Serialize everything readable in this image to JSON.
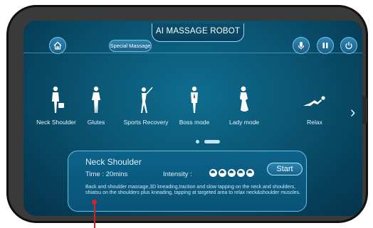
{
  "header": {
    "title": "AI MASSAGE ROBOT",
    "special_label": "Special Massage",
    "icons": [
      "home-icon",
      "microphone-icon",
      "pause-icon",
      "power-icon"
    ]
  },
  "modes": [
    {
      "label": "Neck Shoulder",
      "icon": "person-with-bag-icon"
    },
    {
      "label": "Glutes",
      "icon": "person-standing-icon"
    },
    {
      "label": "Sports Recovery",
      "icon": "golfer-icon"
    },
    {
      "label": "Boss mode",
      "icon": "person-tie-icon"
    },
    {
      "label": "Lady mode",
      "icon": "woman-icon"
    },
    {
      "label": "Relax",
      "icon": "reclining-person-icon"
    }
  ],
  "carousel": {
    "pages": 2,
    "active_page": 2
  },
  "detail": {
    "title": "Neck Shoulder",
    "time_text": "Time : 20mins",
    "intensity_label": "Intensity :",
    "intensity_level": 5,
    "start_label": "Start",
    "description": "Back and shoulder massage,3D kneading,traction and slow tapping on the neck and shoulders, shiatsu on the shoulders plus kneading, tapping at targeted area to relax neck&shoulder muscles."
  },
  "colors": {
    "accent": "#7cc4e6",
    "background": "#0a5573",
    "pointer": "#d2232a"
  }
}
